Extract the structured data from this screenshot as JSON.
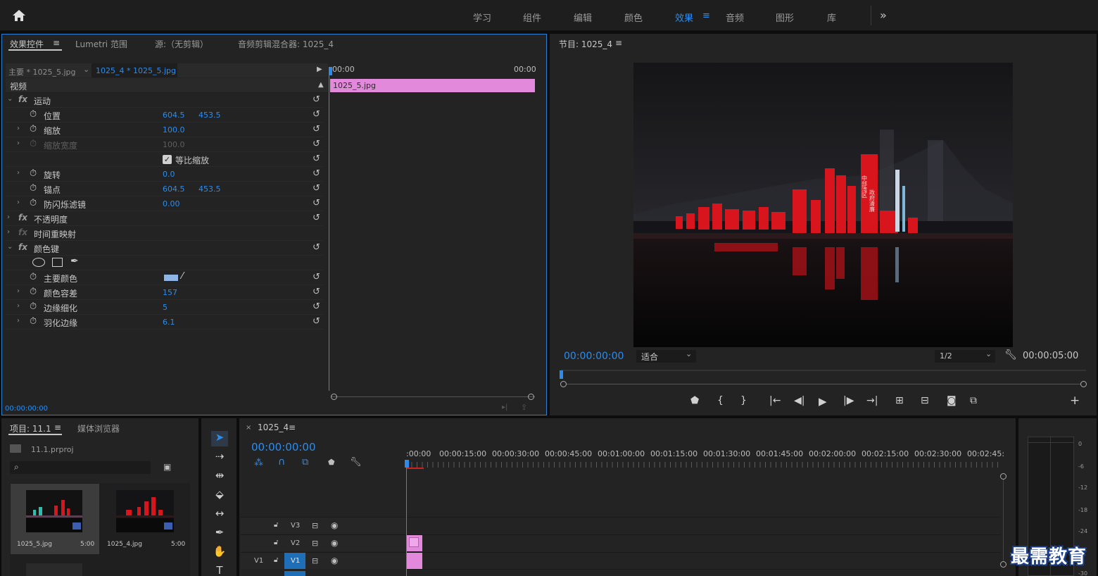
{
  "workspaces": {
    "items": [
      "学习",
      "组件",
      "编辑",
      "颜色",
      "效果",
      "音频",
      "图形",
      "库"
    ],
    "more": "»"
  },
  "effect_controls": {
    "tabs": [
      "效果控件",
      "Lumetri 范围",
      "源:（无剪辑）",
      "音频剪辑混合器: 1025_4"
    ],
    "master": "主要 * 1025_5.jpg",
    "clip": "1025_4 * 1025_5.jpg",
    "tl_start": "00:00",
    "tl_end": "00:00",
    "clip_bar": "1025_5.jpg",
    "section": "视频",
    "rows": [
      {
        "label": "运动"
      },
      {
        "label": "位置",
        "v1": "604.5",
        "v2": "453.5"
      },
      {
        "label": "缩放",
        "v1": "100.0"
      },
      {
        "label": "缩放宽度",
        "v1": "100.0"
      },
      {
        "label": "等比缩放"
      },
      {
        "label": "旋转",
        "v1": "0.0"
      },
      {
        "label": "锚点",
        "v1": "604.5",
        "v2": "453.5"
      },
      {
        "label": "防闪烁滤镜",
        "v1": "0.00"
      },
      {
        "label": "不透明度"
      },
      {
        "label": "时间重映射"
      },
      {
        "label": "颜色键"
      },
      {
        "label": ""
      },
      {
        "label": "主要颜色",
        "color": "#8fb4e6"
      },
      {
        "label": "颜色容差",
        "v1": "157"
      },
      {
        "label": "边缘细化",
        "v1": "5"
      },
      {
        "label": "羽化边缘",
        "v1": "6.1"
      }
    ],
    "timecode": "00:00:00:00"
  },
  "program": {
    "title": "节目: 1025_4",
    "timecode": "00:00:00:00",
    "fit": "适合",
    "quality": "1/2",
    "duration": "00:00:05:00",
    "sign": [
      "中部湾区",
      "政府清廉"
    ]
  },
  "project": {
    "tabs": [
      "项目: 11.1",
      "媒体浏览器"
    ],
    "file": "11.1.prproj",
    "items": [
      {
        "name": "1025_5.jpg",
        "dur": "5:00"
      },
      {
        "name": "1025_4.jpg",
        "dur": "5:00"
      }
    ]
  },
  "timeline": {
    "tab": "1025_4",
    "timecode": "00:00:00:00",
    "ruler": [
      ":00:00",
      "00:00:15:00",
      "00:00:30:00",
      "00:00:45:00",
      "00:01:00:00",
      "00:01:15:00",
      "00:01:30:00",
      "00:01:45:00",
      "00:02:00:00",
      "00:02:15:00",
      "00:02:30:00",
      "00:02:45:"
    ],
    "tracks": [
      {
        "name": "V3",
        "src": ""
      },
      {
        "name": "V2",
        "src": ""
      },
      {
        "name": "V1",
        "src": "V1"
      }
    ]
  },
  "meter": {
    "scale": [
      "0",
      "-6",
      "-12",
      "-18",
      "-24",
      "-30"
    ]
  },
  "watermark": "最需教育",
  "colors": {
    "accent": "#2d8ceb",
    "clip": "#e389dc"
  }
}
